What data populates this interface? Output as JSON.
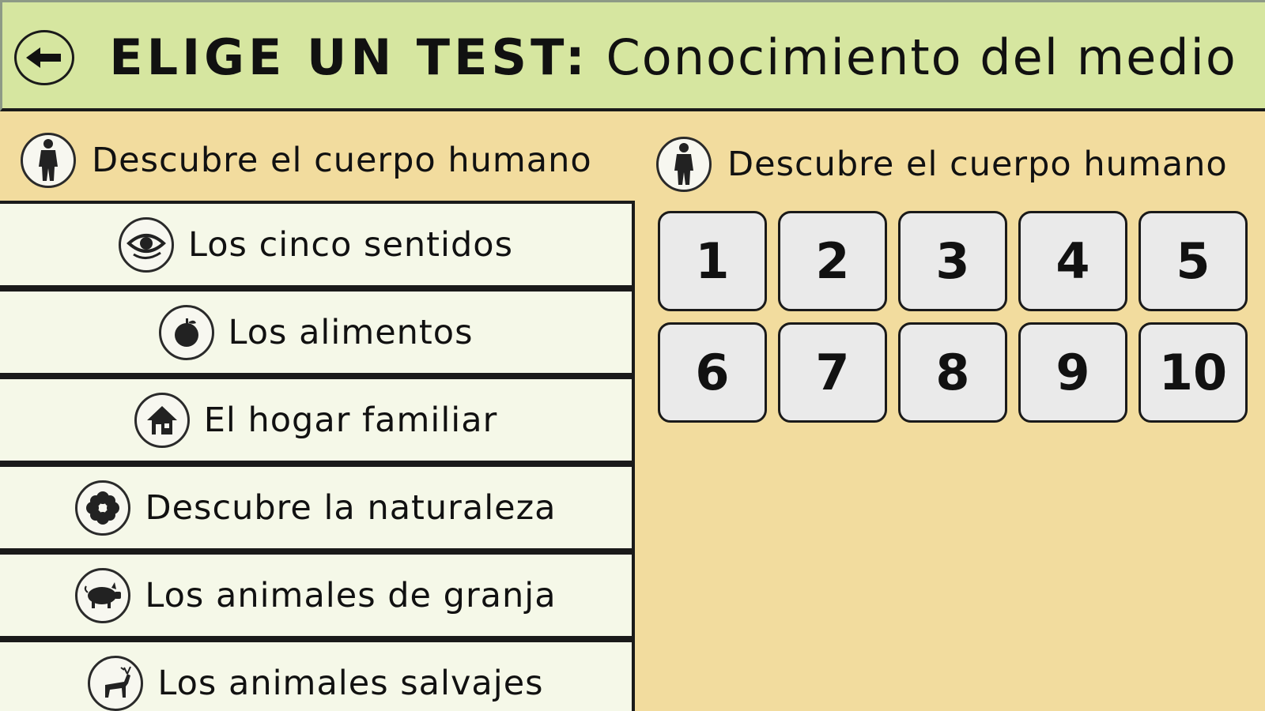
{
  "header": {
    "back_icon": "arrow-left-icon",
    "title_kicker": "ELIGE UN TEST:",
    "title_subject": "Conocimiento del medio"
  },
  "left_panel": {
    "heading": {
      "icon": "human-body-icon",
      "label": "Descubre el cuerpo humano"
    },
    "topics": [
      {
        "icon": "eye-icon",
        "label": "Los cinco sentidos"
      },
      {
        "icon": "apple-icon",
        "label": "Los alimentos"
      },
      {
        "icon": "house-icon",
        "label": "El hogar familiar"
      },
      {
        "icon": "flower-icon",
        "label": "Descubre la naturaleza"
      },
      {
        "icon": "pig-icon",
        "label": "Los animales de granja"
      },
      {
        "icon": "deer-icon",
        "label": "Los animales salvajes"
      }
    ]
  },
  "right_panel": {
    "heading": {
      "icon": "human-body-icon",
      "label": "Descubre el cuerpo humano"
    },
    "tests": [
      "1",
      "2",
      "3",
      "4",
      "5",
      "6",
      "7",
      "8",
      "9",
      "10"
    ]
  },
  "colors": {
    "header_bg": "#d6e6a0",
    "page_bg": "#f2dc9e",
    "list_item_bg": "#f5f8e8",
    "button_bg": "#eaeaea",
    "border": "#1a1a1a"
  }
}
